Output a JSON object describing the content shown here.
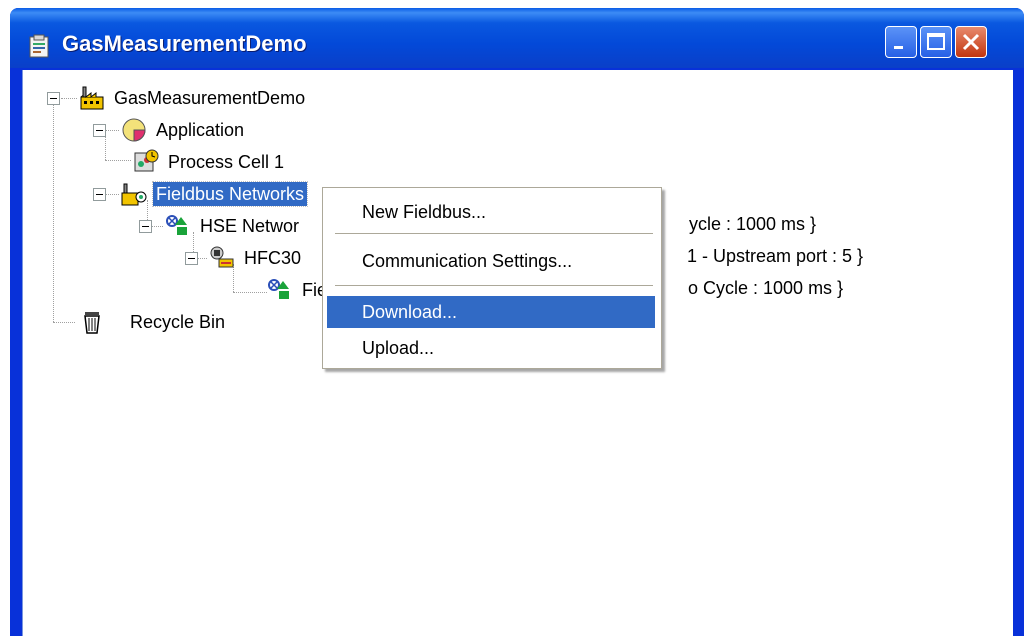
{
  "window": {
    "title": "GasMeasurementDemo",
    "controls": {
      "minimize": "minimize",
      "maximize": "maximize",
      "close": "close"
    }
  },
  "tree": {
    "root": {
      "label": "GasMeasurementDemo",
      "icon": "factory-icon"
    },
    "application": {
      "label": "Application",
      "icon": "pie-chart-icon"
    },
    "process_cell": {
      "label": "Process Cell 1",
      "icon": "process-cell-icon"
    },
    "fieldbus_networks": {
      "label": "Fieldbus Networks",
      "icon": "network-factory-icon",
      "selected": true
    },
    "hse_network": {
      "label": "HSE Networ",
      "suffix": "ycle : 1000 ms  }",
      "icon": "network-icon"
    },
    "hfc": {
      "label": "HFC30",
      "suffix": "1 -  Upstream port : 5 }",
      "icon": "bridge-device-icon"
    },
    "fieldbus": {
      "label": "Fie",
      "suffix": "o Cycle : 1000 ms  }",
      "icon": "network-icon"
    },
    "recycle_bin": {
      "label": "Recycle Bin",
      "icon": "trash-icon"
    }
  },
  "context_menu": {
    "items": [
      {
        "label": "New Fieldbus..."
      },
      {
        "label": "Communication Settings..."
      },
      {
        "label": "Download...",
        "highlighted": true
      },
      {
        "label": "Upload..."
      }
    ]
  },
  "colors": {
    "titlebar": "#0349d8",
    "selection": "#316ac5",
    "close_button": "#c2350f"
  }
}
